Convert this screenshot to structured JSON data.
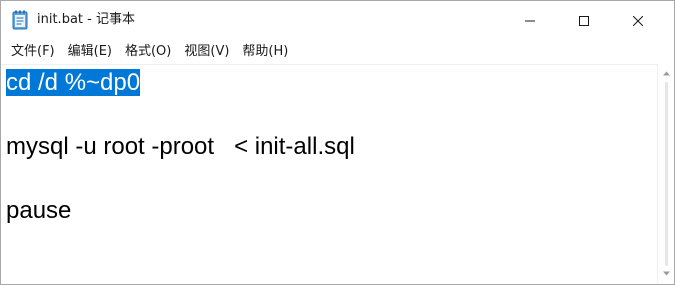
{
  "window": {
    "title": "init.bat - 记事本",
    "icons": {
      "app": "notepad-icon",
      "minimize": "minimize-icon",
      "maximize": "maximize-icon",
      "close": "close-icon"
    }
  },
  "menu": {
    "items": [
      {
        "label": "文件(F)"
      },
      {
        "label": "编辑(E)"
      },
      {
        "label": "格式(O)"
      },
      {
        "label": "视图(V)"
      },
      {
        "label": "帮助(H)"
      }
    ]
  },
  "editor": {
    "lines": [
      {
        "text": "cd /d %~dp0",
        "selected": true
      },
      {
        "text": ""
      },
      {
        "text": "mysql -u root -proot   < init-all.sql"
      },
      {
        "text": ""
      },
      {
        "text": "pause"
      }
    ],
    "selection_color": "#0078d7"
  },
  "scrollbar": {
    "icons": {
      "up": "scroll-up-arrow-icon",
      "down": "scroll-down-arrow-icon"
    }
  }
}
